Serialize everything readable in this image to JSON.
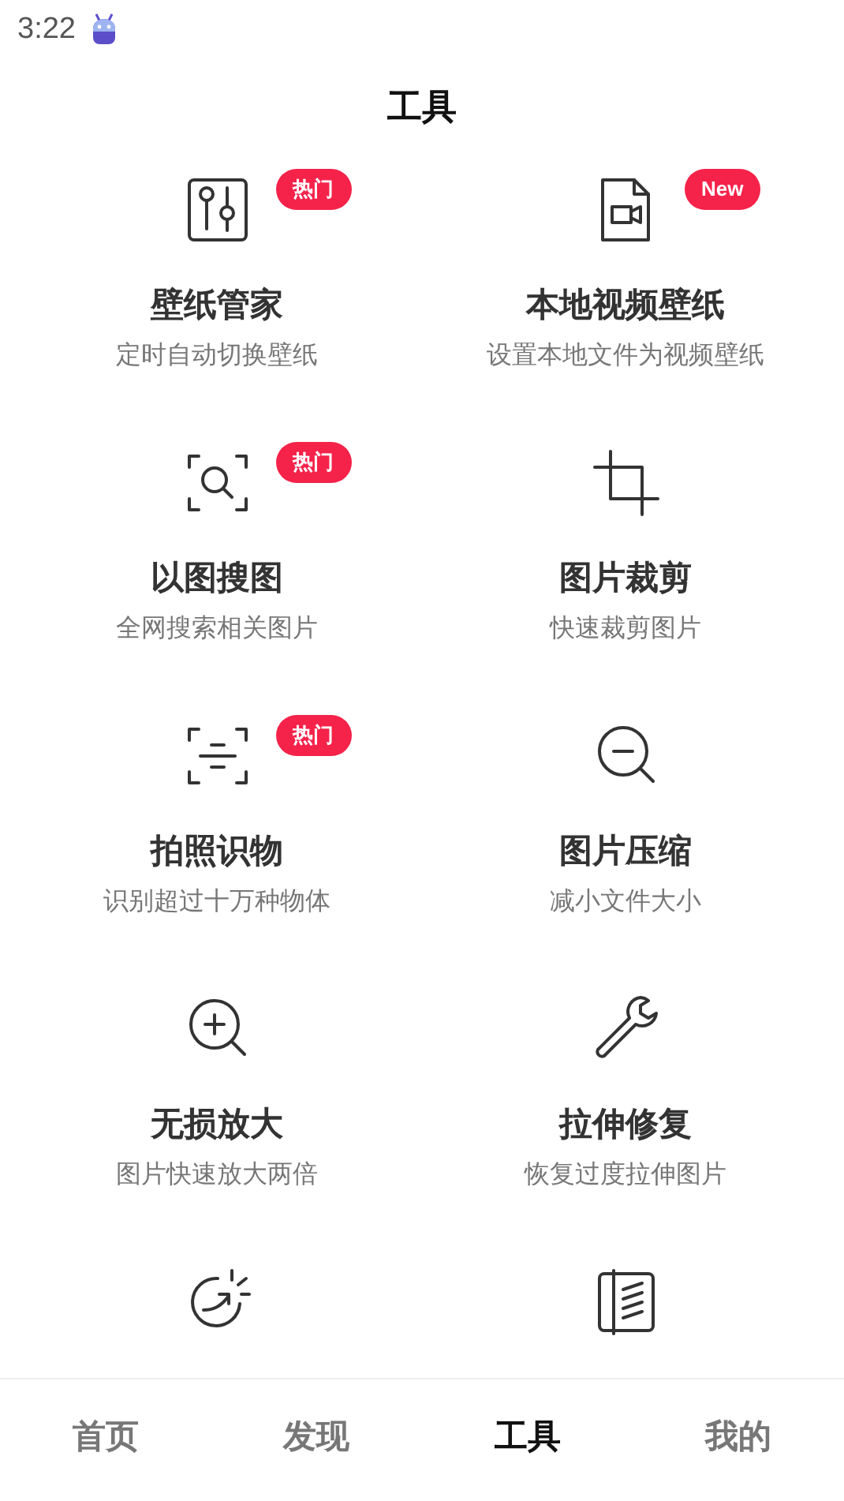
{
  "status_bar": {
    "time": "3:22"
  },
  "header": {
    "title": "工具"
  },
  "tools": [
    {
      "kind": "labeled",
      "title": "壁纸管家",
      "subtitle": "定时自动切换壁纸",
      "badge": "热门"
    },
    {
      "kind": "labeled",
      "title": "本地视频壁纸",
      "subtitle": "设置本地文件为视频壁纸",
      "badge": "New"
    },
    {
      "kind": "labeled",
      "title": "以图搜图",
      "subtitle": "全网搜索相关图片",
      "badge": "热门"
    },
    {
      "kind": "labeled",
      "title": "图片裁剪",
      "subtitle": "快速裁剪图片"
    },
    {
      "kind": "labeled",
      "title": "拍照识物",
      "subtitle": "识别超过十万种物体",
      "badge": "热门"
    },
    {
      "kind": "labeled",
      "title": "图片压缩",
      "subtitle": "减小文件大小"
    },
    {
      "kind": "labeled",
      "title": "无损放大",
      "subtitle": "图片快速放大两倍"
    },
    {
      "kind": "labeled",
      "title": "拉伸修复",
      "subtitle": "恢复过度拉伸图片"
    },
    {
      "kind": "icon_only"
    },
    {
      "kind": "icon_only"
    }
  ],
  "tabs": [
    {
      "label": "首页",
      "selected": false
    },
    {
      "label": "发现",
      "selected": false
    },
    {
      "label": "工具",
      "selected": true
    },
    {
      "label": "我的",
      "selected": false
    }
  ]
}
